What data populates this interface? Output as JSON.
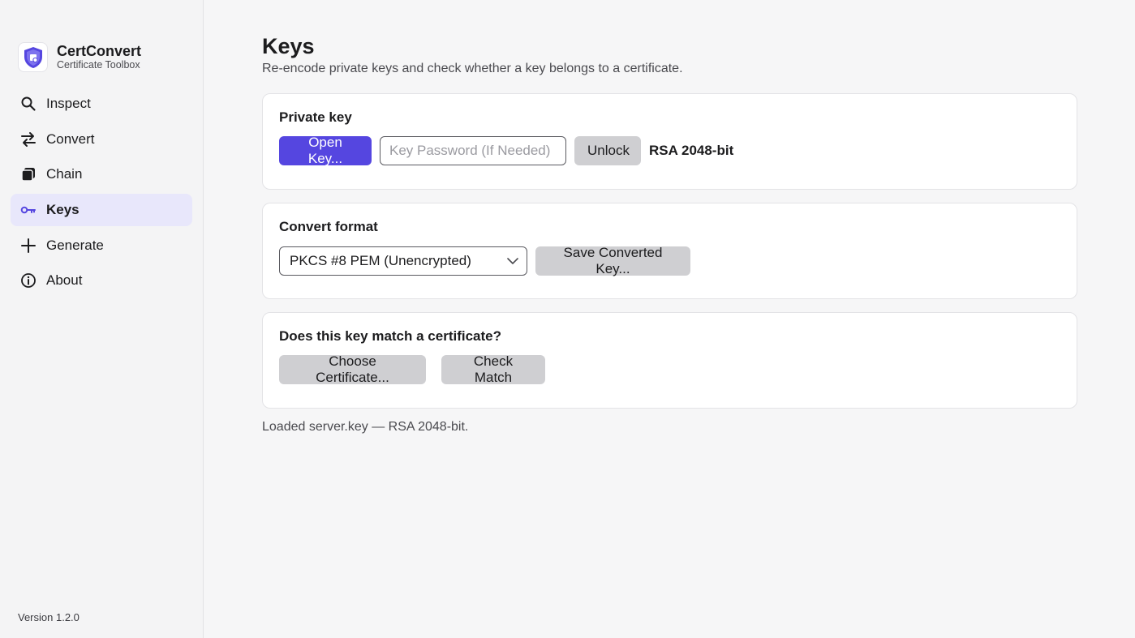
{
  "app": {
    "name": "CertConvert",
    "subtitle": "Certificate Toolbox",
    "version": "Version 1.2.0",
    "accent": "#5546e0"
  },
  "sidebar": {
    "items": [
      {
        "label": "Inspect",
        "icon": "search-icon",
        "active": false
      },
      {
        "label": "Convert",
        "icon": "swap-icon",
        "active": false
      },
      {
        "label": "Chain",
        "icon": "stack-icon",
        "active": false
      },
      {
        "label": "Keys",
        "icon": "key-icon",
        "active": true
      },
      {
        "label": "Generate",
        "icon": "plus-icon",
        "active": false
      },
      {
        "label": "About",
        "icon": "info-icon",
        "active": false
      }
    ]
  },
  "page": {
    "title": "Keys",
    "subtitle": "Re-encode private keys and check whether a key belongs to a certificate."
  },
  "private_key": {
    "title": "Private key",
    "open_label": "Open Key...",
    "password_placeholder": "Key Password (If Needed)",
    "password_value": "",
    "unlock_label": "Unlock",
    "key_info": "RSA 2048-bit"
  },
  "convert": {
    "title": "Convert format",
    "selected_format": "PKCS #8 PEM (Unencrypted)",
    "save_label": "Save Converted Key..."
  },
  "match": {
    "title": "Does this key match a certificate?",
    "choose_label": "Choose Certificate...",
    "check_label": "Check Match"
  },
  "status": "Loaded server.key — RSA 2048-bit."
}
